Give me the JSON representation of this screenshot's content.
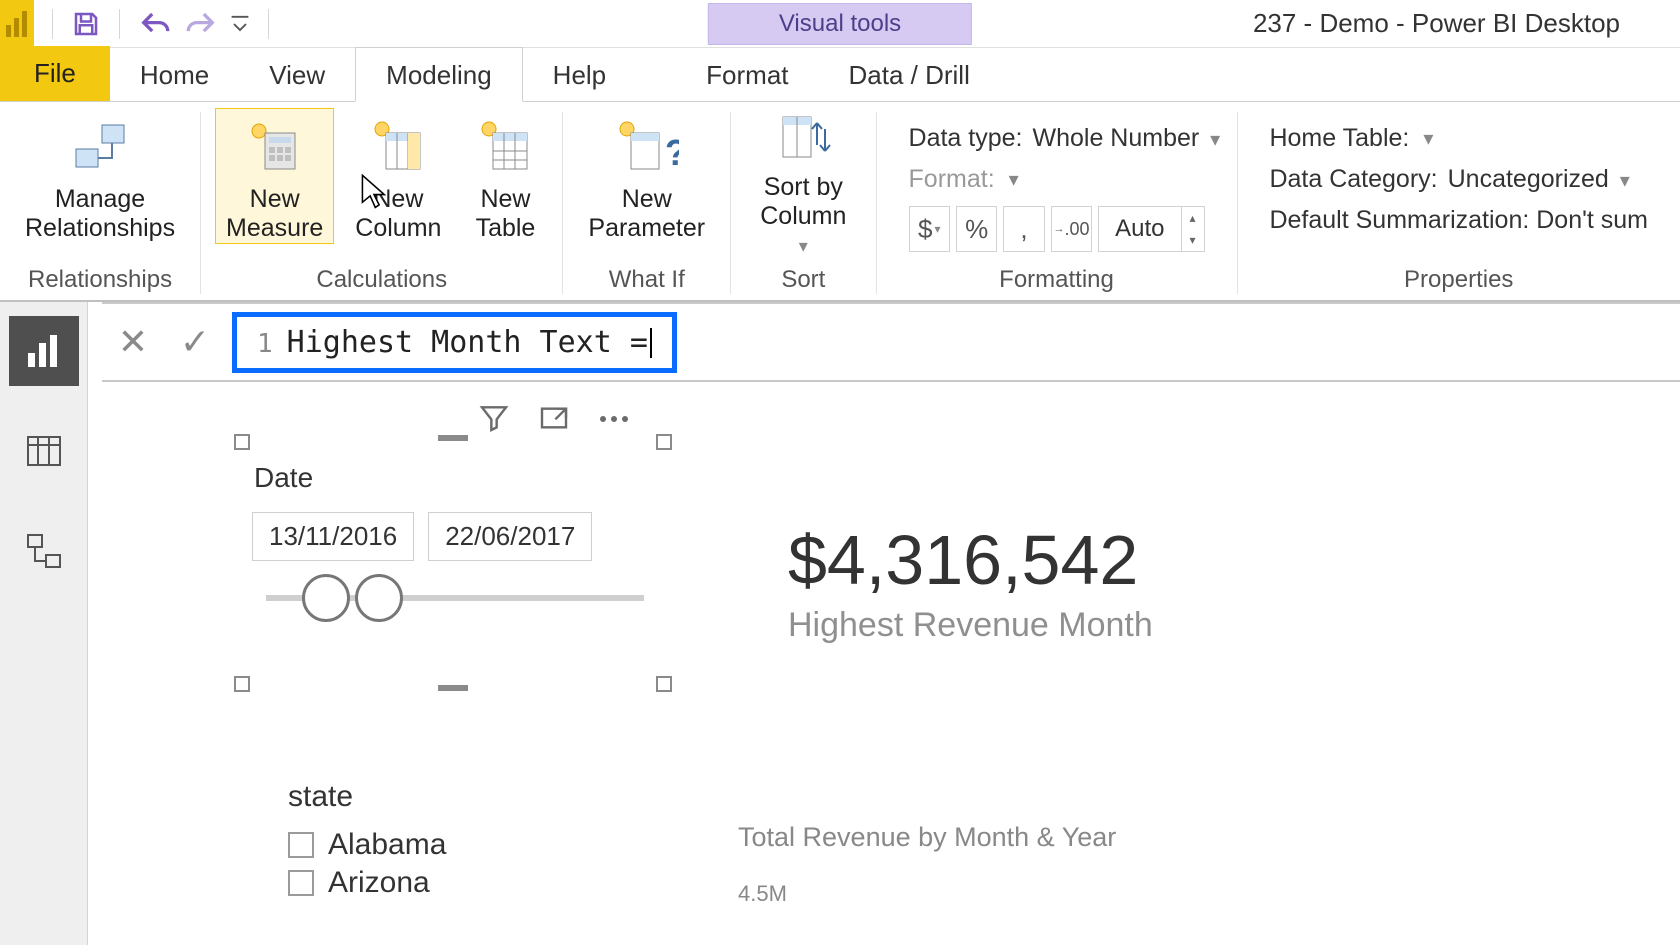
{
  "title_bar": {
    "visual_tools": "Visual tools",
    "document_title": "237 - Demo - Power BI Desktop"
  },
  "menu": {
    "file": "File",
    "home": "Home",
    "view": "View",
    "modeling": "Modeling",
    "help": "Help",
    "format": "Format",
    "data_drill": "Data / Drill"
  },
  "ribbon": {
    "relationships": {
      "manage_relationships": "Manage\nRelationships",
      "group_label": "Relationships"
    },
    "calculations": {
      "new_measure": "New\nMeasure",
      "new_column": "New\nColumn",
      "new_table": "New\nTable",
      "group_label": "Calculations"
    },
    "whatif": {
      "new_parameter": "New\nParameter",
      "group_label": "What If"
    },
    "sort": {
      "sort_by_column": "Sort by\nColumn",
      "group_label": "Sort"
    },
    "formatting": {
      "data_type_label": "Data type:",
      "data_type_value": "Whole Number",
      "format_label": "Format:",
      "currency_symbol": "$",
      "percent_symbol": "%",
      "thousands_symbol": ",",
      "decimal_symbol": ".00",
      "auto_label": "Auto",
      "group_label": "Formatting"
    },
    "properties": {
      "home_table_label": "Home Table:",
      "data_category_label": "Data Category:",
      "data_category_value": "Uncategorized",
      "default_summarization": "Default Summarization: Don't sum",
      "group_label": "Properties"
    }
  },
  "formula_bar": {
    "line_number": "1",
    "text": "Highest Month Text ="
  },
  "date_slicer": {
    "title": "Date",
    "start": "13/11/2016",
    "end": "22/06/2017"
  },
  "kpi": {
    "value": "$4,316,542",
    "label": "Highest Revenue Month"
  },
  "state_slicer": {
    "title": "state",
    "items": [
      "Alabama",
      "Arizona"
    ]
  },
  "chart": {
    "title": "Total Revenue by Month & Year",
    "y_tick_top": "4.5M"
  }
}
